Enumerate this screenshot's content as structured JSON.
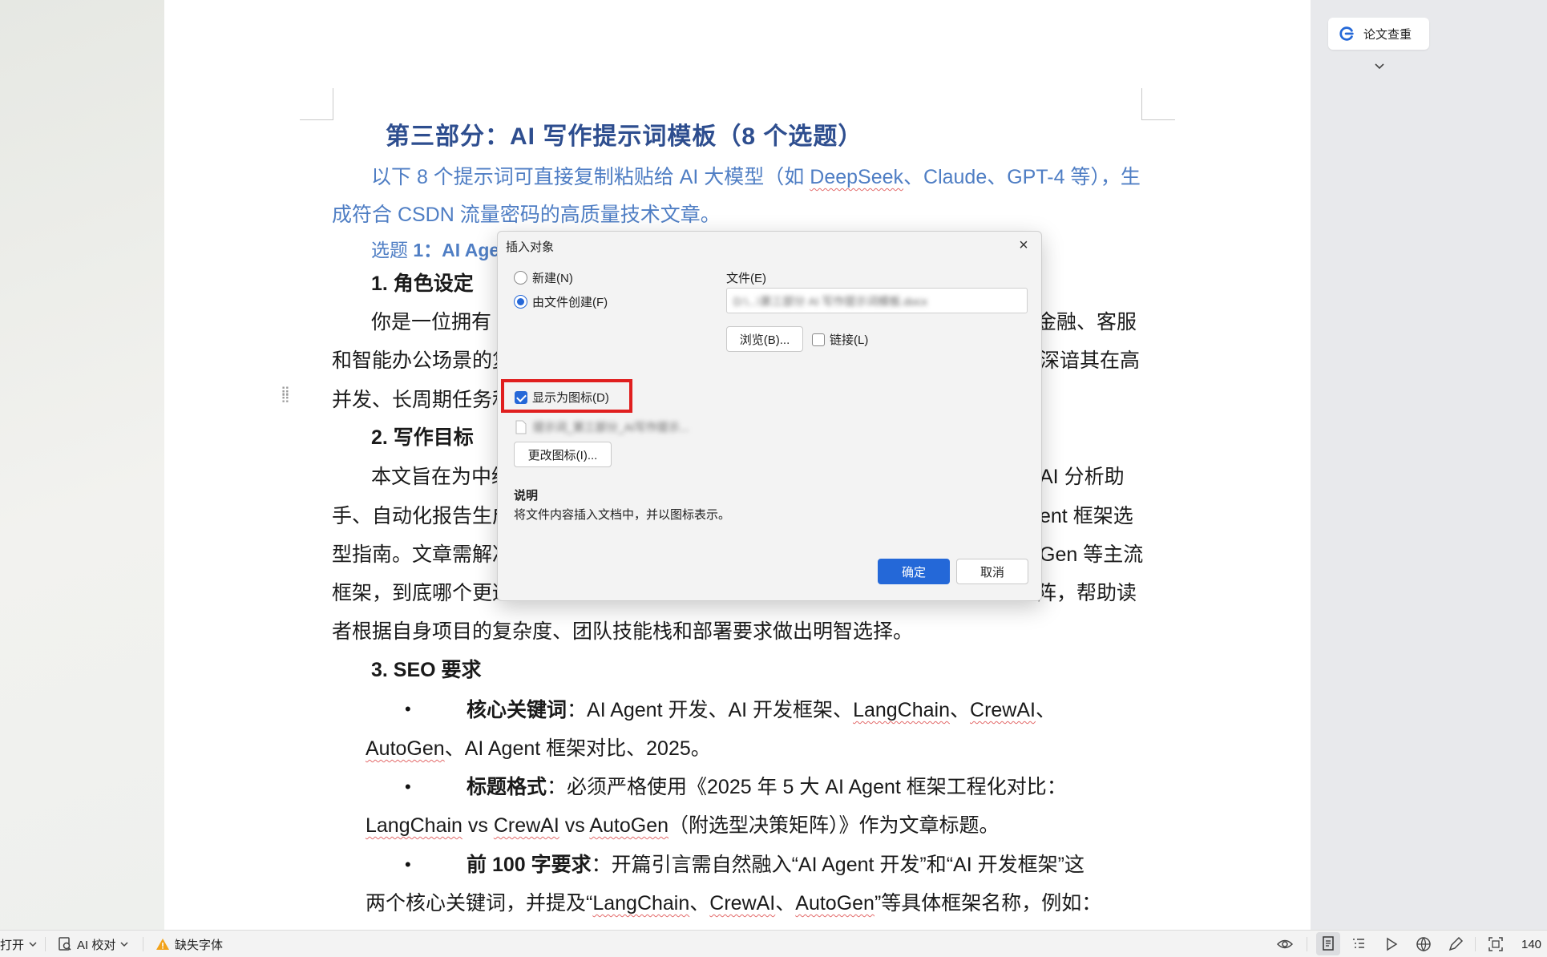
{
  "document": {
    "heading": "第三部分：AI 写作提示词模板（8 个选题）",
    "intro_line1": "以下 8 个提示词可直接复制粘贴给 AI 大模型（如 DeepSeek、Claude、GPT-4 等），生",
    "intro_line2": "成符合 CSDN 流量密码的高质量技术文章。",
    "topic_prefix": "选题 1：AI Age",
    "section1_title": "1. 角色设定",
    "p1_line1_left": "你是一位拥有",
    "p1_line1_right": "金融、客服",
    "p1_line2_left": "和智能办公场景的复",
    "p1_line2_right": "深谙其在高",
    "p1_line3_left": "并发、长周期任务和",
    "section2_title": "2. 写作目标",
    "p2_line1_left": "本文旨在为中级",
    "p2_line1_right": "AI 分析助",
    "p2_line2_left": "手、自动化报告生成",
    "p2_line2_right": "ent 框架选",
    "p2_line3_left": "型指南。文章需解决",
    "p2_line3_right": "Gen 等主流",
    "p2_line4_left": "框架，到底哪个更适",
    "p2_line4_right": "阵，帮助读",
    "p2_line5": "者根据自身项目的复杂度、团队技能栈和部署要求做出明智选择。",
    "section3_title": "3. SEO 要求",
    "bullet1_label": "核心关键词",
    "bullet1_text": "：AI Agent 开发、AI 开发框架、LangChain、CrewAI、",
    "bullet1_cont": "AutoGen、AI Agent 框架对比、2025。",
    "bullet2_label": "标题格式",
    "bullet2_text": "：必须严格使用《2025 年 5 大 AI Agent 框架工程化对比：",
    "bullet2_cont": "LangChain vs CrewAI vs AutoGen（附选型决策矩阵）》作为文章标题。",
    "bullet3_label": "前 100 字要求",
    "bullet3_text": "：开篇引言需自然融入“AI Agent 开发”和“AI 开发框架”这",
    "bullet3_cont": "两个核心关键词，并提及“LangChain、CrewAI、AutoGen”等具体框架名称，例如：",
    "bullet_symbol": "•"
  },
  "right_panel": {
    "check_button_label": "论文查重"
  },
  "dialog": {
    "title": "插入对象",
    "close_symbol": "×",
    "radio_new": "新建(N)",
    "radio_from_file": "由文件创建(F)",
    "file_label": "文件(E)",
    "file_value": "D:\\...\\第三部分 AI 写作提示词模板.docx",
    "browse_button": "浏览(B)...",
    "link_checkbox": "链接(L)",
    "display_icon_checkbox": "显示为图标(D)",
    "icon_filename": "提示词_第三部分_AI写作提示...",
    "change_icon_button": "更改图标(I)...",
    "desc_title": "说明",
    "desc_text": "将文件内容插入文档中，并以图标表示。",
    "ok_button": "确定",
    "cancel_button": "取消"
  },
  "statusbar": {
    "open_label": "打开",
    "proof_label": "AI 校对",
    "missing_font_label": "缺失字体",
    "zoom_value": "140"
  },
  "colors": {
    "heading": "#2e4e8f",
    "link_blue": "#4f7ec4",
    "primary_button": "#2468d8",
    "highlight_red": "#e01f1f"
  },
  "icons": [
    "grammar-check-icon",
    "chevron-down-icon",
    "close-icon",
    "file-icon",
    "proof-icon",
    "warning-icon",
    "eye-icon",
    "page-view-icon",
    "outline-icon",
    "play-icon",
    "globe-icon",
    "pen-icon",
    "fit-screen-icon",
    "drag-handle-icon"
  ]
}
